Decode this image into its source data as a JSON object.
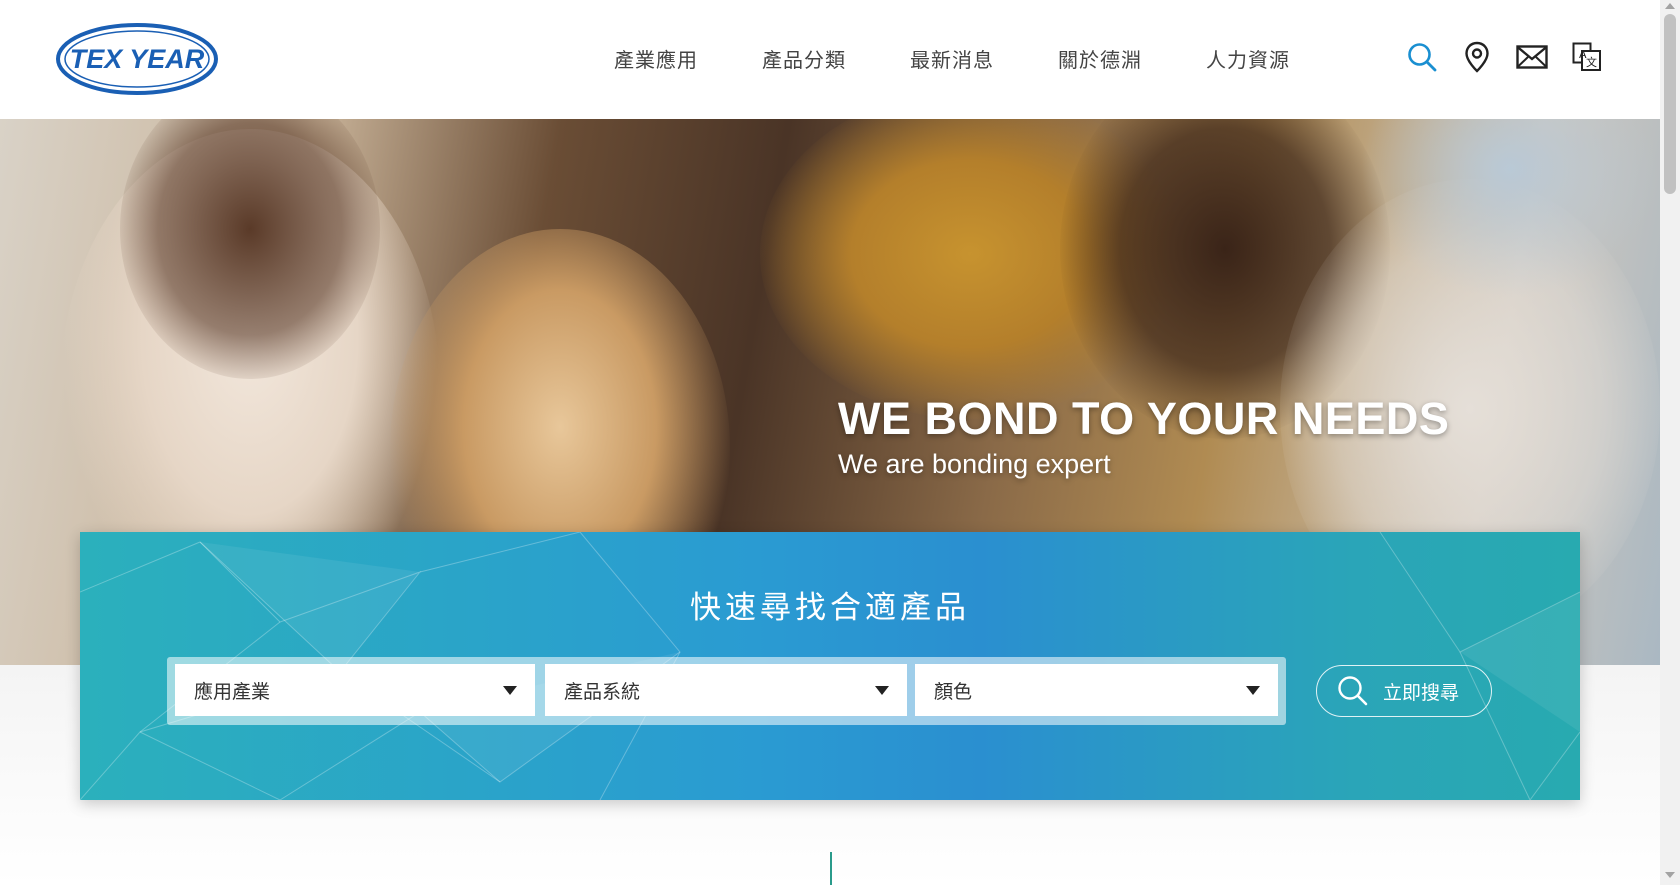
{
  "brand": {
    "logo_text": "TEX YEAR",
    "color": "#1a5fb4"
  },
  "nav": {
    "items": [
      "產業應用",
      "產品分類",
      "最新消息",
      "關於德淵",
      "人力資源"
    ]
  },
  "header_icons": [
    "search-icon",
    "location-pin-icon",
    "mail-icon",
    "translate-icon"
  ],
  "hero": {
    "title": "WE BOND TO YOUR NEEDS",
    "subtitle": "We are bonding expert"
  },
  "search_panel": {
    "title": "快速尋找合適產品",
    "selects": [
      {
        "value": "應用產業"
      },
      {
        "value": "產品系統"
      },
      {
        "value": "顏色"
      }
    ],
    "button_label": "立即搜尋"
  },
  "colors": {
    "accent": "#1a8fd1",
    "panel_start": "#2bb0bc",
    "panel_mid": "#2a9bd2",
    "divider": "#2a9b8b"
  }
}
